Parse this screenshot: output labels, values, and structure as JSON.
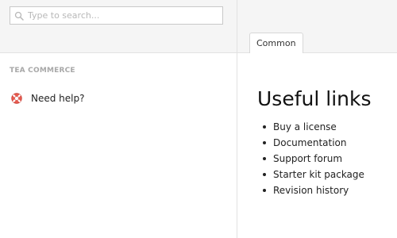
{
  "search": {
    "placeholder": "Type to search..."
  },
  "sidebar": {
    "section_title": "TEA COMMERCE",
    "items": [
      {
        "label": "Need help?",
        "icon": "lifebuoy-icon"
      }
    ]
  },
  "tabs": [
    {
      "label": "Common"
    }
  ],
  "main": {
    "title": "Useful links",
    "links": [
      "Buy a license",
      "Documentation",
      "Support forum",
      "Starter kit package",
      "Revision history"
    ]
  },
  "colors": {
    "header_bg": "#f5f5f5",
    "divider": "#e2e2e2",
    "section_title": "#a8a8a8",
    "icon_red": "#d9534f"
  }
}
